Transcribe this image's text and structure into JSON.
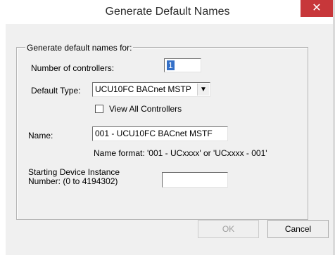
{
  "dialog": {
    "title": "Generate Default Names",
    "close_glyph": "✕"
  },
  "group": {
    "legend": "Generate default names for:"
  },
  "controllers": {
    "label": "Number of controllers:",
    "value": "1"
  },
  "default_type": {
    "label": "Default Type:",
    "value": "UCU10FC BACnet MSTP",
    "arrow": "▼"
  },
  "view_all": {
    "label": "View All Controllers",
    "checked": false
  },
  "name": {
    "label": "Name:",
    "value": "001 - UCU10FC BACnet MSTF",
    "format_hint": "Name format: '001 - UCxxxx' or 'UCxxxx - 001'"
  },
  "starting_instance": {
    "label_line1": "Starting Device Instance",
    "label_line2": "Number: (0 to 4194302)",
    "value": ""
  },
  "buttons": {
    "ok": "OK",
    "cancel": "Cancel"
  }
}
